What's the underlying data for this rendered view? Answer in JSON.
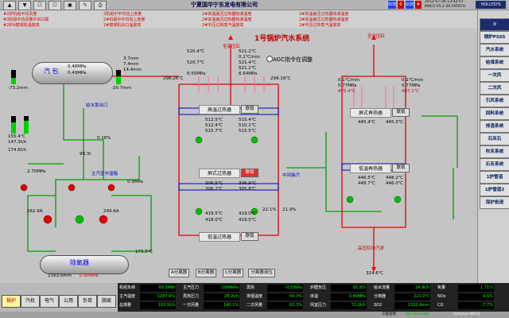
{
  "topbar": {
    "company": "宁夏国华宁东发电有限公司",
    "icons": [
      "▲",
      "▼",
      "☐",
      "☐",
      "▣",
      "✎",
      "⎙"
    ],
    "status": [
      {
        "label": "SOE",
        "color": "#2040ff"
      },
      {
        "label": "0",
        "color": "#d00000"
      },
      {
        "label": "SOE",
        "color": "#2040ff"
      },
      {
        "label": "#",
        "color": "#d00000"
      }
    ],
    "clock_lines": [
      "2012-07-30 13:42:57",
      "MACS V5.2 SX  FATO?U"
    ],
    "logo": "HOLLYSYS"
  },
  "alarms": [
    "#2炉机组平均风量",
    "2机组中平均加上度量",
    "2#高温差压过热器热通温度",
    "2#高温差压过热器热通温度",
    "#3机组平均风量中出口联",
    "2#机组中平均加上度量",
    "2#高温差压过热器热通温度",
    "2#高温差压过热器热通温度",
    "#2炉A磨煤机温度高",
    "2#磨煤机出口温度高",
    "2#中压过热蒸汽温度高",
    "2#中压过热蒸汽温度高"
  ],
  "main": {
    "title": "1号锅炉汽水系统",
    "agc": "AGC指令在调整",
    "drum": {
      "label": "汽 包",
      "value1": "0.48MPa",
      "value2": "0.49MPa",
      "left_level": "-73.2mm",
      "right_level": "-20.7mm",
      "level_a": "3.7mm",
      "level_b": "7.4mm",
      "level_c": "14.4mm"
    },
    "deaerator": {
      "label": "除氧器",
      "level": "2163.0mm",
      "pressure": "0.90MPa",
      "temp": "173.5℃"
    },
    "feedwater": {
      "flow_label": "给水泵出口",
      "pressure": "2.70MPa",
      "flow1": "162.9A",
      "flow2": "249.6A",
      "temp1": "155.4℃",
      "temp2": "147.3t/h",
      "val_a": "0.16%",
      "val_b": "99.3t",
      "val_c": "174.6t/h"
    },
    "boxes": [
      {
        "label": "高温过热器",
        "btn": "联锁"
      },
      {
        "label": "屏式过热器",
        "btn": "联锁"
      },
      {
        "label": "低温过热器",
        "btn": "联锁"
      },
      {
        "label": "屏式再热器",
        "btn": "联锁"
      },
      {
        "label": "低温再热器",
        "btn": "联锁"
      }
    ],
    "labels": [
      "至高压缸",
      "至中压缸",
      "高压缸排汽来",
      "主汽至中温箱",
      "中间抽汽",
      "A分离器",
      "B分离器",
      "C分离器",
      "分离器液位"
    ],
    "values": [
      "520.4℃",
      "521.2℃",
      "0.1℃/min",
      "520.7℃",
      "521.4℃",
      "521.2℃",
      "6.55MPa",
      "6.54MPa",
      "298.26℃",
      "299.18℃",
      "512.5℃",
      "515.4℃",
      "512.4℃",
      "510.1℃",
      "515.7℃",
      "515.5℃",
      "445.4℃",
      "445.3℃",
      "0.1℃/min",
      "0.1℃/min",
      "475.4℃",
      "487.1℃",
      "0.77MPa",
      "0.77MPa",
      "419.5℃",
      "419.0℃",
      "418.0℃",
      "419.5℃",
      "306.5℃",
      "306.9℃",
      "306.2℃",
      "305.8℃",
      "324.6℃",
      "446.5℃",
      "448.2℃",
      "448.7℃",
      "446.0℃",
      "0.9MPa",
      "22.1%",
      "21.9%"
    ]
  },
  "nav": {
    "items": [
      "锅炉PSSS",
      "汽水系统",
      "给煤系统",
      "一次风",
      "二次风",
      "引风系统",
      "回料系统",
      "排渣系统",
      "石灰石",
      "吹灰系统",
      "石灰系统",
      "1炉管道",
      "1炉管道2",
      "保护投退"
    ]
  },
  "tabs": [
    "锅炉",
    "汽机",
    "电气",
    "公用",
    "负荷",
    "脱硫"
  ],
  "bottom": {
    "rows": [
      [
        {
          "l": "机组负荷",
          "v": "60.3MW"
        },
        {
          "l": "主汽压力",
          "v": "2999kPa"
        },
        {
          "l": "再热",
          "v": "-0.53kPa"
        },
        {
          "l": "炉膛负压",
          "v": "81.9%"
        },
        {
          "l": "给水流量",
          "v": "14.9t/h"
        },
        {
          "l": "氧量",
          "v": "1.71%"
        }
      ],
      [
        {
          "l": "主汽温度",
          "v": "1287.6%"
        },
        {
          "l": "再热压力",
          "v": "28.2t/h"
        },
        {
          "l": "排烟温度",
          "v": "56.3%"
        },
        {
          "l": "床温",
          "v": "3.80MPa"
        },
        {
          "l": "分离器",
          "v": "221.0℃"
        },
        {
          "l": "NOx",
          "v": "6.5%"
        }
      ],
      [
        {
          "l": "总煤量",
          "v": "193.5t/h"
        },
        {
          "l": "一次风量",
          "v": "140.1%"
        },
        {
          "l": "二次风量",
          "v": "62.3%"
        },
        {
          "l": "风室压力",
          "v": "51.0t/h"
        },
        {
          "l": "SO2",
          "v": "1322.4mm"
        },
        {
          "l": "CO",
          "v": "-7.7%"
        }
      ]
    ]
  },
  "footer": {
    "left": "工程名称",
    "mid": "SCS-Selected",
    "right": "HollySys MACS"
  }
}
